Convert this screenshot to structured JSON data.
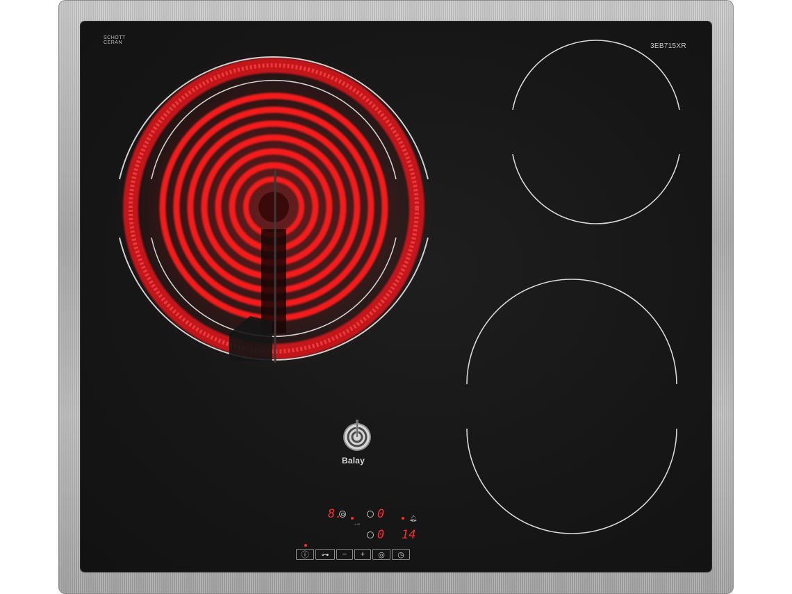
{
  "hob": {
    "model": "3EB715XR",
    "glass_brand": "SCHOTT CERAN",
    "glass_brand_line1": "SCHOTT",
    "glass_brand_line2": "CERAN",
    "brand": "Balay"
  },
  "zones": [
    {
      "id": "front-left",
      "state": "on",
      "glow_color": "#ff1a1a"
    },
    {
      "id": "back-right",
      "state": "off"
    },
    {
      "id": "front-right",
      "state": "off"
    }
  ],
  "display": {
    "power_level": "8.",
    "zone_level_a": "0",
    "zone_level_b": "0",
    "timer_value": "14",
    "sub_label": "1-40"
  },
  "controls": [
    {
      "name": "power-button",
      "label": "ⓘ",
      "width": 26
    },
    {
      "name": "child-lock-button",
      "label": "⊶",
      "width": 28
    },
    {
      "name": "minus-button",
      "label": "−",
      "width": 24
    },
    {
      "name": "plus-button",
      "label": "+",
      "width": 24
    },
    {
      "name": "dual-zone-button",
      "label": "◎",
      "width": 26
    },
    {
      "name": "timer-button",
      "label": "◷",
      "width": 26
    }
  ],
  "colors": {
    "frame": "#b5b5b5",
    "glass": "#171717",
    "display_red": "#ff2a2a",
    "zone_outline": "#d8d8d8"
  }
}
